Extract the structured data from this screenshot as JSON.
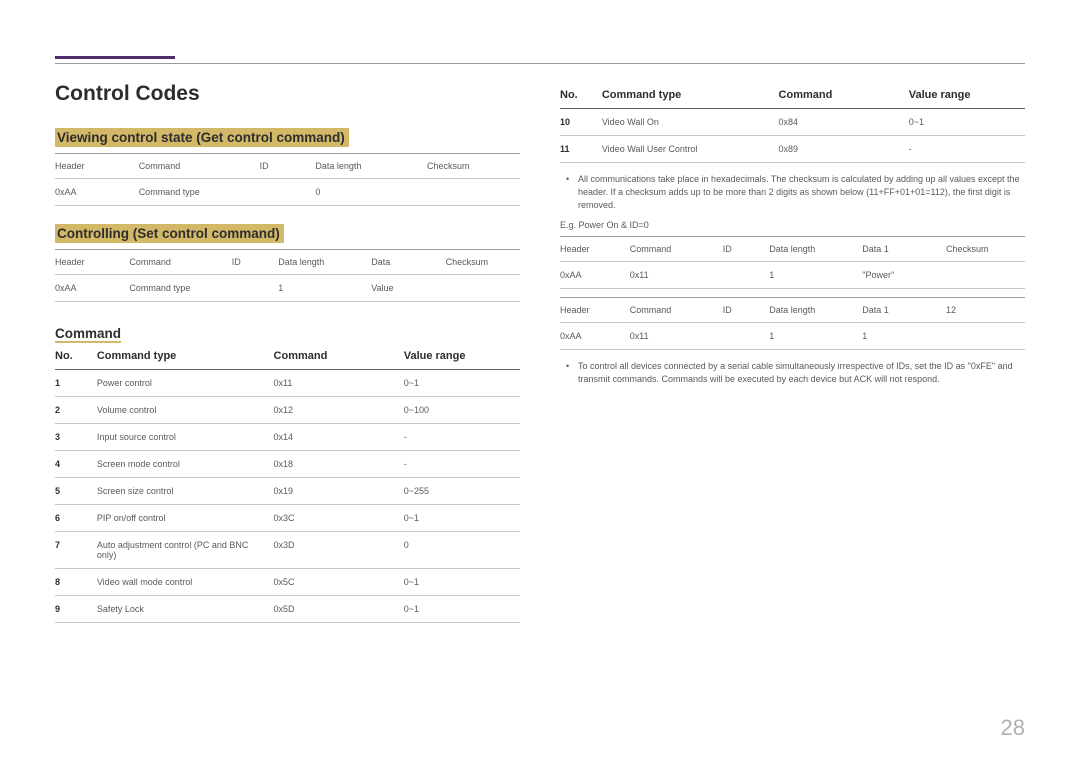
{
  "page_number": "28",
  "title": "Control Codes",
  "sections": {
    "viewing": {
      "heading": "Viewing control state (Get control command)",
      "headers": [
        "Header",
        "Command",
        "ID",
        "Data length",
        "Checksum"
      ],
      "row": [
        "0xAA",
        "Command type",
        "",
        "0",
        ""
      ]
    },
    "controlling": {
      "heading": "Controlling (Set control command)",
      "headers": [
        "Header",
        "Command",
        "ID",
        "Data length",
        "Data",
        "Checksum"
      ],
      "row": [
        "0xAA",
        "Command type",
        "",
        "1",
        "Value",
        ""
      ]
    },
    "command": {
      "heading": "Command",
      "headers": [
        "No.",
        "Command type",
        "Command",
        "Value range"
      ],
      "rows": [
        [
          "1",
          "Power control",
          "0x11",
          "0~1"
        ],
        [
          "2",
          "Volume control",
          "0x12",
          "0~100"
        ],
        [
          "3",
          "Input source control",
          "0x14",
          "-"
        ],
        [
          "4",
          "Screen mode control",
          "0x18",
          "-"
        ],
        [
          "5",
          "Screen size control",
          "0x19",
          "0~255"
        ],
        [
          "6",
          "PIP on/off control",
          "0x3C",
          "0~1"
        ],
        [
          "7",
          "Auto adjustment control (PC and BNC only)",
          "0x3D",
          "0"
        ],
        [
          "8",
          "Video wall mode control",
          "0x5C",
          "0~1"
        ],
        [
          "9",
          "Safety Lock",
          "0x5D",
          "0~1"
        ]
      ]
    },
    "command_cont": {
      "headers": [
        "No.",
        "Command type",
        "Command",
        "Value range"
      ],
      "rows": [
        [
          "10",
          "Video Wall On",
          "0x84",
          "0~1"
        ],
        [
          "11",
          "Video Wall User Control",
          "0x89",
          "-"
        ]
      ]
    },
    "note1": "All communications take place in hexadecimals. The checksum is calculated by adding up all values except the header. If a checksum adds up to be more than 2 digits as shown below (11+FF+01+01=112), the first digit is removed.",
    "eg_label": "E.g. Power On & ID=0",
    "eg_table1": {
      "headers": [
        "Header",
        "Command",
        "ID",
        "Data length",
        "Data 1",
        "Checksum"
      ],
      "row": [
        "0xAA",
        "0x11",
        "",
        "1",
        "\"Power\"",
        ""
      ]
    },
    "eg_table2": {
      "headers": [
        "Header",
        "Command",
        "ID",
        "Data length",
        "Data 1",
        "12"
      ],
      "row": [
        "0xAA",
        "0x11",
        "",
        "1",
        "1",
        ""
      ]
    },
    "note2": "To control all devices connected by a serial cable simultaneously irrespective of IDs, set the ID as \"0xFE\" and transmit commands. Commands will be executed by each device but ACK will not respond."
  }
}
